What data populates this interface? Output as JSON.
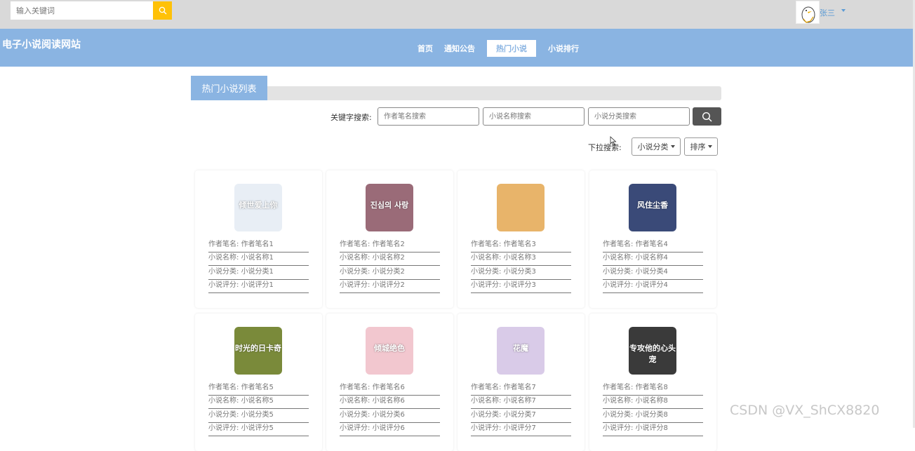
{
  "header": {
    "search_placeholder": "输入关键词",
    "user_name": "张三"
  },
  "site_title": "电子小说阅读网站",
  "nav": {
    "items": [
      {
        "label": "首页"
      },
      {
        "label": "通知公告"
      },
      {
        "label": "热门小说"
      },
      {
        "label": "小说排行"
      }
    ],
    "active_index": 2
  },
  "section": {
    "title": "热门小说列表"
  },
  "search": {
    "keyword_label": "关键字搜索:",
    "author_placeholder": "作者笔名搜索",
    "name_placeholder": "小说名称搜索",
    "category_placeholder": "小说分类搜索"
  },
  "dropdown": {
    "label": "下拉搜索:",
    "category_label": "小说分类",
    "sort_label": "排序"
  },
  "field_labels": {
    "author": "作者笔名:",
    "name": "小说名称:",
    "category": "小说分类:",
    "rating": "小说评分:"
  },
  "novels": [
    {
      "author": "作者笔名1",
      "name": "小说名称1",
      "category": "小说分类1",
      "rating": "小说评分1",
      "cover_color": "#e8eef5",
      "cover_text": "倾世爱上你"
    },
    {
      "author": "作者笔名2",
      "name": "小说名称2",
      "category": "小说分类2",
      "rating": "小说评分2",
      "cover_color": "#9a6b78",
      "cover_text": "진심의 사랑"
    },
    {
      "author": "作者笔名3",
      "name": "小说名称3",
      "category": "小说分类3",
      "rating": "小说评分3",
      "cover_color": "#e8b46a",
      "cover_text": ""
    },
    {
      "author": "作者笔名4",
      "name": "小说名称4",
      "category": "小说分类4",
      "rating": "小说评分4",
      "cover_color": "#3a4a78",
      "cover_text": "风住尘香"
    },
    {
      "author": "作者笔名5",
      "name": "小说名称5",
      "category": "小说分类5",
      "rating": "小说评分5",
      "cover_color": "#7a8a3a",
      "cover_text": "时光的日卡奇"
    },
    {
      "author": "作者笔名6",
      "name": "小说名称6",
      "category": "小说分类6",
      "rating": "小说评分6",
      "cover_color": "#f2c7cf",
      "cover_text": "倾城绝色"
    },
    {
      "author": "作者笔名7",
      "name": "小说名称7",
      "category": "小说分类7",
      "rating": "小说评分7",
      "cover_color": "#d9cbe8",
      "cover_text": "花魔"
    },
    {
      "author": "作者笔名8",
      "name": "小说名称8",
      "category": "小说分类8",
      "rating": "小说评分8",
      "cover_color": "#3a3a3a",
      "cover_text": "专攻他的心头宠"
    }
  ],
  "watermark": "CSDN @VX_ShCX8820"
}
